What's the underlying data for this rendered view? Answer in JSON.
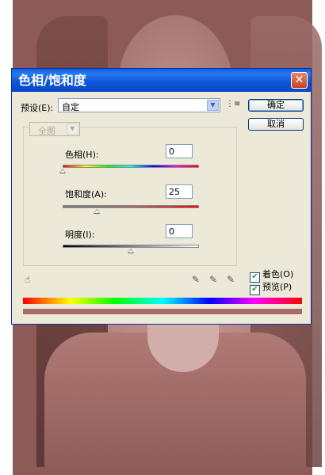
{
  "dialog": {
    "title": "色相/饱和度",
    "close_glyph": "✕"
  },
  "preset": {
    "label": "预设(E):",
    "value": "自定",
    "menu_icon_glyph": "⋮≡"
  },
  "buttons": {
    "ok": "确定",
    "cancel": "取消"
  },
  "channel": {
    "value": "全图"
  },
  "sliders": {
    "hue": {
      "label": "色相(H):",
      "value": "0",
      "level": 0.0
    },
    "saturation": {
      "label": "饱和度(A):",
      "value": "25",
      "level": 0.25
    },
    "lightness": {
      "label": "明度(I):",
      "value": "0",
      "level": 0.0
    }
  },
  "options": {
    "colorize": {
      "label": "着色(O)",
      "checked": true
    },
    "preview": {
      "label": "预览(P)",
      "checked": true
    }
  },
  "icons": {
    "hand": "hand-adjust-icon",
    "droppers": [
      "eyedropper-icon",
      "eyedropper-plus-icon",
      "eyedropper-minus-icon"
    ]
  },
  "colors": {
    "title_bar": "#0a5fe4",
    "result_color": "#a86c6a"
  }
}
